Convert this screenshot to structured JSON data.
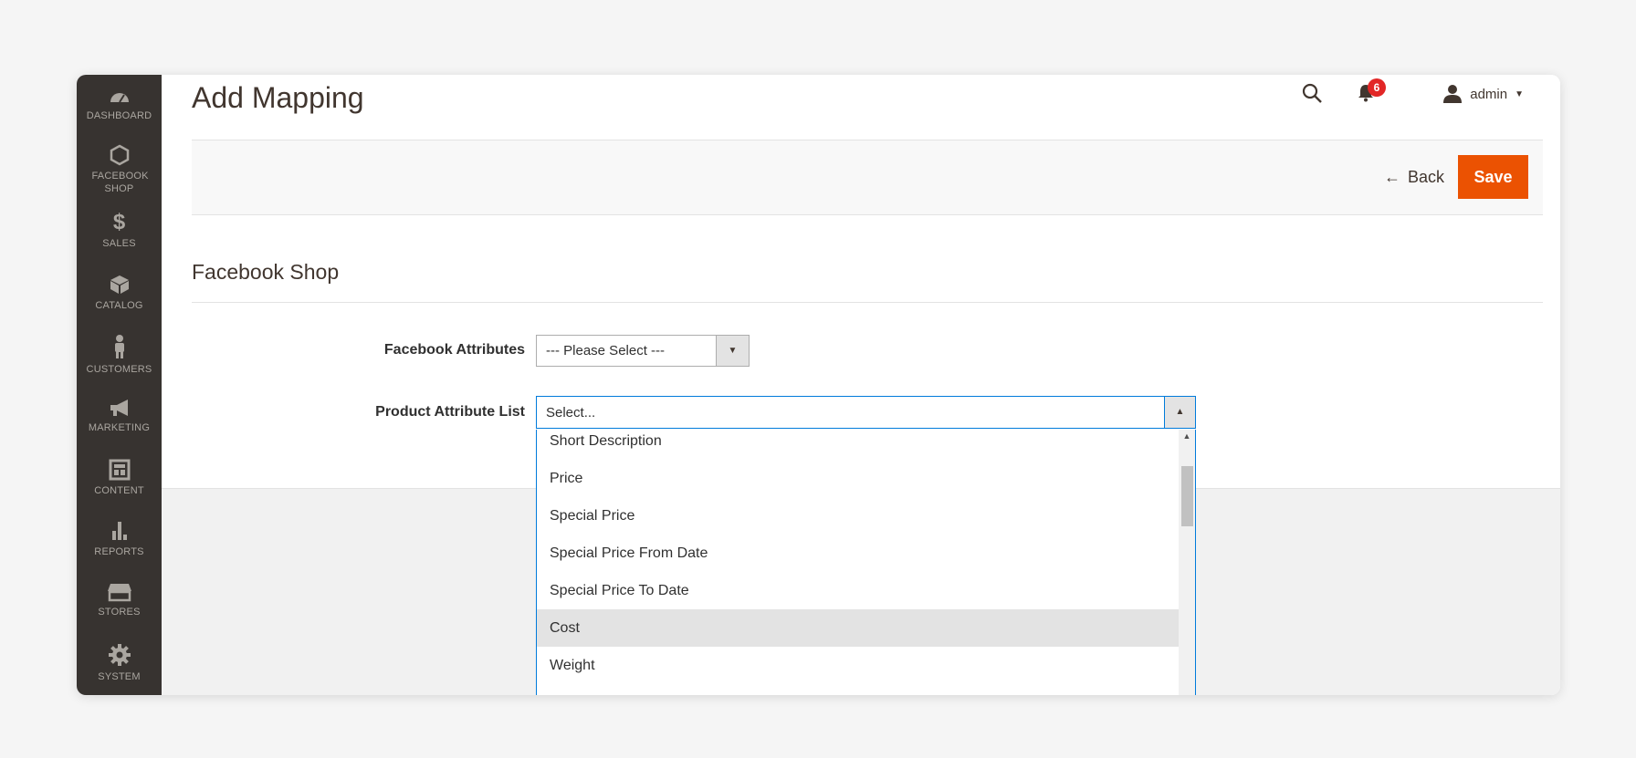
{
  "sidebar": {
    "items": [
      {
        "label": "DASHBOARD",
        "icon": "dashboard-icon"
      },
      {
        "label": "FACEBOOK SHOP",
        "icon": "hexagon-icon"
      },
      {
        "label": "SALES",
        "icon": "dollar-icon"
      },
      {
        "label": "CATALOG",
        "icon": "cube-icon"
      },
      {
        "label": "CUSTOMERS",
        "icon": "person-icon"
      },
      {
        "label": "MARKETING",
        "icon": "megaphone-icon"
      },
      {
        "label": "CONTENT",
        "icon": "layout-icon"
      },
      {
        "label": "REPORTS",
        "icon": "bar-chart-icon"
      },
      {
        "label": "STORES",
        "icon": "store-icon"
      },
      {
        "label": "SYSTEM",
        "icon": "gear-icon"
      }
    ]
  },
  "header": {
    "title": "Add Mapping",
    "notifications_count": "6",
    "user_name": "admin"
  },
  "actions": {
    "back_label": "Back",
    "save_label": "Save"
  },
  "form": {
    "section_title": "Facebook Shop",
    "facebook_attributes": {
      "label": "Facebook Attributes",
      "value": "--- Please Select ---"
    },
    "product_attribute_list": {
      "label": "Product Attribute List",
      "placeholder": "Select...",
      "options": [
        "Short Description",
        "Price",
        "Special Price",
        "Special Price From Date",
        "Special Price To Date",
        "Cost",
        "Weight"
      ],
      "highlighted": "Cost"
    }
  },
  "colors": {
    "sidebar": "#373330",
    "accent": "#eb5202",
    "badge": "#e22626",
    "focus_border": "#007bdb"
  }
}
